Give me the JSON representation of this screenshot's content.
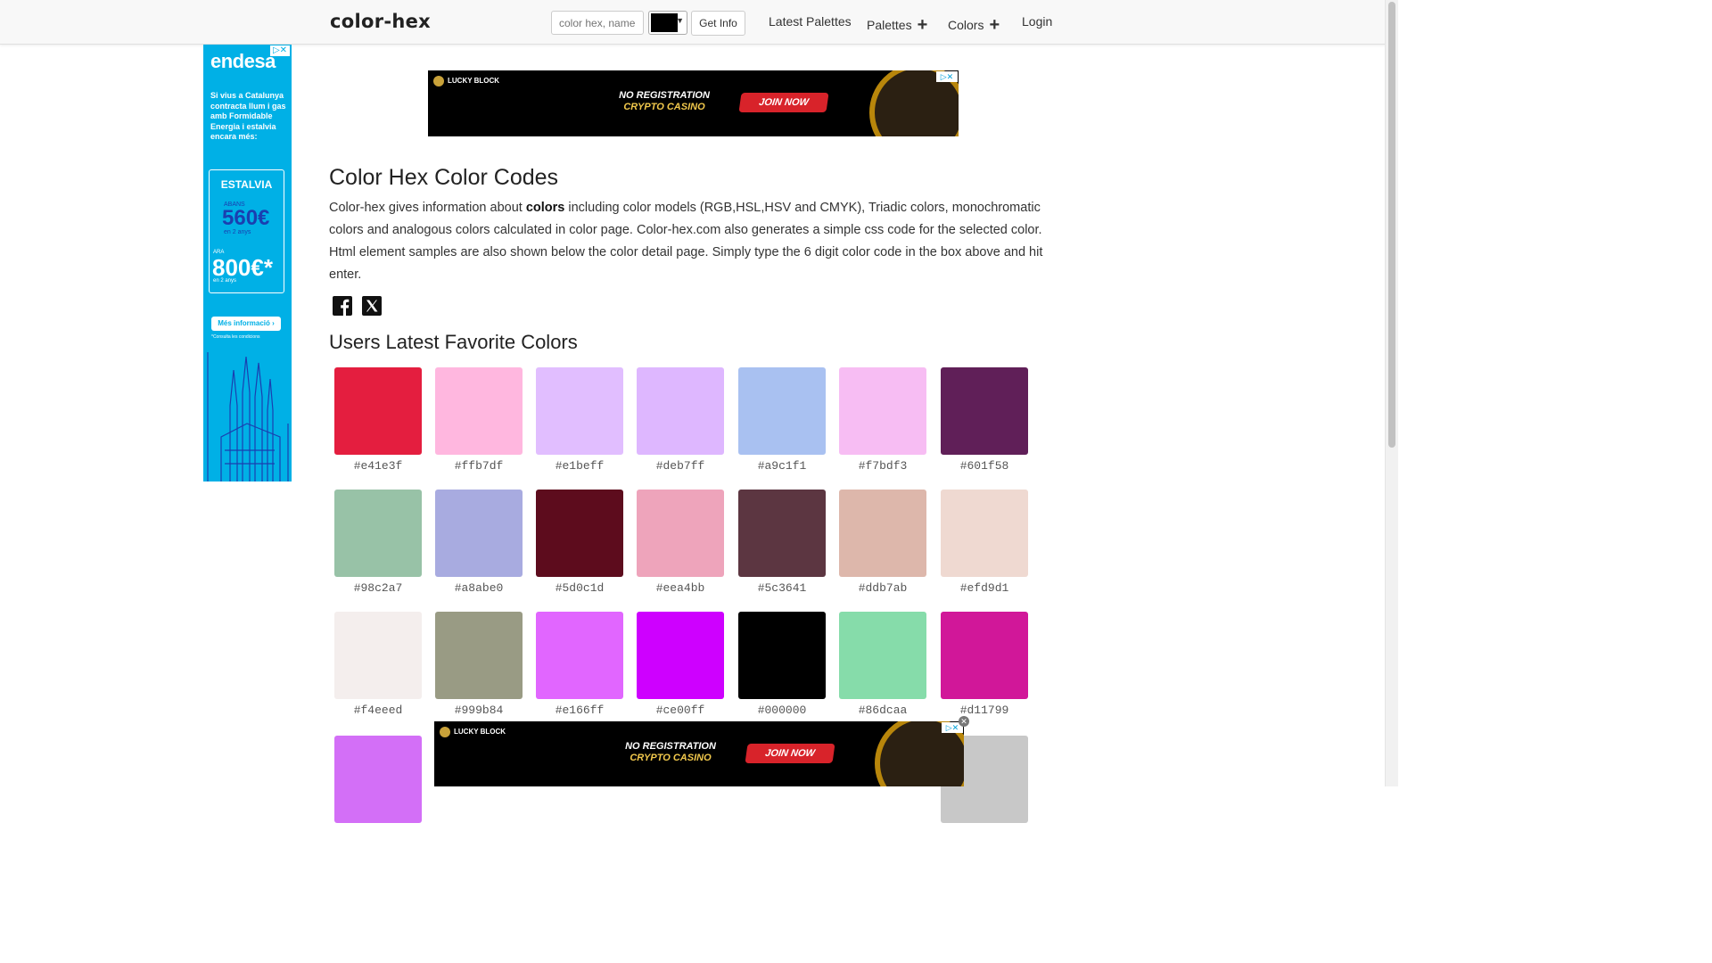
{
  "header": {
    "brand": "color-hex",
    "search_placeholder": "color hex, name, rgb",
    "get_info_label": "Get Info",
    "nav": [
      {
        "label": "Latest Palettes",
        "has_plus": false
      },
      {
        "label": "Palettes",
        "has_plus": true
      },
      {
        "label": "Colors",
        "has_plus": true
      },
      {
        "label": "Login",
        "has_plus": false
      }
    ],
    "picker_color": "#000000"
  },
  "side_ad": {
    "logo": "endesa",
    "text": "Si vius a Catalunya contracta llum i gas amb Formidable Energia i estalvia encara més:",
    "box_heading": "ESTALVIA",
    "pre_price_1": "ABANS",
    "price_1": "560€",
    "sub_1": "en 2 anys",
    "pre_price_2": "ARA",
    "price_2": "800€*",
    "sub_2": "en 2 anys",
    "cta": "Més informació ›",
    "conditions": "*Consulta les condicions"
  },
  "banner_ad": {
    "brand": "LUCKY BLOCK",
    "line1": "NO REGISTRATION",
    "line2": "CRYPTO CASINO",
    "cta": "JOIN NOW"
  },
  "main": {
    "title": "Color Hex Color Codes",
    "intro_pre": "Color-hex gives information about ",
    "intro_bold": "colors",
    "intro_post": " including color models (RGB,HSL,HSV and CMYK), Triadic colors, monochromatic colors and analogous colors calculated in color page. Color-hex.com also generates a simple css code for the selected color. Html element samples are also shown below the color detail page. Simply type the 6 digit color code in the box above and hit enter.",
    "favorites_title": "Users Latest Favorite Colors",
    "colors": [
      {
        "hex": "#e41e3f"
      },
      {
        "hex": "#ffb7df"
      },
      {
        "hex": "#e1beff"
      },
      {
        "hex": "#deb7ff"
      },
      {
        "hex": "#a9c1f1"
      },
      {
        "hex": "#f7bdf3"
      },
      {
        "hex": "#601f58"
      },
      {
        "hex": "#98c2a7"
      },
      {
        "hex": "#a8abe0"
      },
      {
        "hex": "#5d0c1d"
      },
      {
        "hex": "#eea4bb"
      },
      {
        "hex": "#5c3641"
      },
      {
        "hex": "#ddb7ab"
      },
      {
        "hex": "#efd9d1"
      },
      {
        "hex": "#f4eeed"
      },
      {
        "hex": "#999b84"
      },
      {
        "hex": "#e166ff"
      },
      {
        "hex": "#ce00ff"
      },
      {
        "hex": "#000000"
      },
      {
        "hex": "#86dcaa"
      },
      {
        "hex": "#d11799"
      }
    ],
    "partial_row_colors": [
      "#d36ff7",
      "#c8c8c8"
    ]
  }
}
